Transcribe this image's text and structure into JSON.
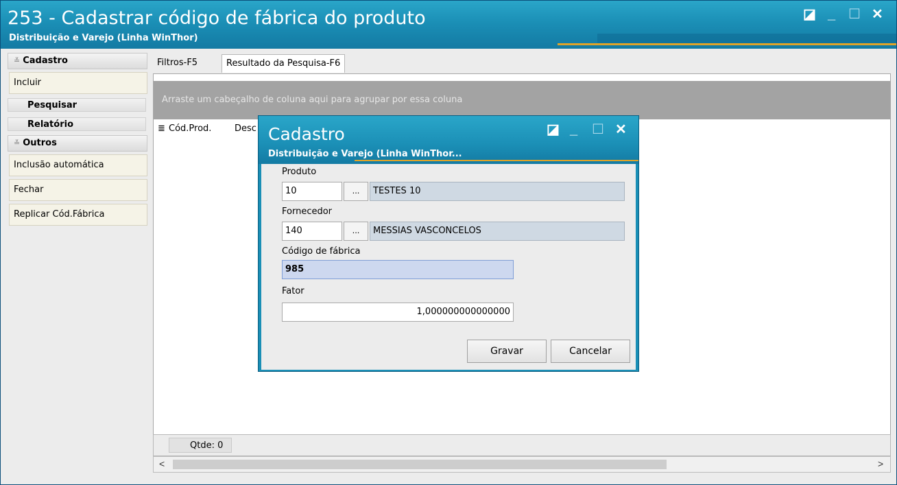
{
  "window": {
    "title": "253 - Cadastrar código de fábrica do produto",
    "subtitle": "Distribuição e Varejo (Linha WinThor)",
    "controls": {
      "restore": "◪",
      "minimize": "_",
      "maximize": "☐",
      "close": "✕"
    }
  },
  "sidebar": {
    "cadastro": {
      "header": "Cadastro",
      "items": [
        "Incluir"
      ]
    },
    "pesquisar": "Pesquisar",
    "relatorio": "Relatório",
    "outros": {
      "header": "Outros",
      "items": [
        "Inclusão automática",
        "Fechar",
        "Replicar Cód.Fábrica"
      ]
    }
  },
  "tabs": [
    "Filtros-F5",
    "Resultado da Pesquisa-F6"
  ],
  "grid": {
    "group_hint": "Arraste um cabeçalho de coluna aqui para agrupar por essa coluna",
    "columns": [
      "Cód.Prod.",
      "Desc"
    ]
  },
  "footer": {
    "qtde": "Qtde: 0"
  },
  "scroll": {
    "left": "<",
    "right": ">"
  },
  "dialog": {
    "title": "Cadastro",
    "subtitle": "Distribuição e Varejo (Linha WinThor...",
    "produto": {
      "label": "Produto",
      "code": "10",
      "dots": "...",
      "name": "TESTES 10"
    },
    "fornecedor": {
      "label": "Fornecedor",
      "code": "140",
      "dots": "...",
      "name": "MESSIAS VASCONCELOS"
    },
    "codigo": {
      "label": "Código de fábrica",
      "value": "985"
    },
    "fator": {
      "label": "Fator",
      "value": "1,000000000000000"
    },
    "buttons": {
      "save": "Gravar",
      "cancel": "Cancelar"
    }
  },
  "colors": {
    "titlebar": "#1b8fb6",
    "accent": "#e0a428",
    "focus_field": "#cdd8ef"
  }
}
